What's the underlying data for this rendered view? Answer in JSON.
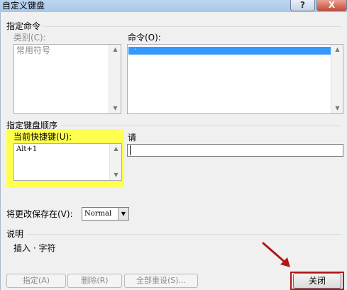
{
  "window": {
    "title": "自定义键盘",
    "help": "?",
    "close": "X"
  },
  "specify_command": {
    "heading": "指定命令",
    "categories_label": "类别(C):",
    "categories": [
      "常用符号"
    ],
    "commands_label": "命令(O):",
    "commands": [
      "·"
    ]
  },
  "keyboard_sequence": {
    "heading": "指定键盘顺序",
    "current_keys_label": "当前快捷键(U):",
    "current_keys": [
      "Alt+1"
    ],
    "press_label": "请",
    "press_value": ""
  },
  "save_in": {
    "label": "将更改保存在(V):",
    "value": "Normal"
  },
  "description": {
    "heading": "说明",
    "text": "插入 · 字符"
  },
  "buttons": {
    "assign": "指定(A)",
    "remove": "删除(R)",
    "reset_all": "全部重设(S)...",
    "close": "关闭"
  },
  "colors": {
    "highlight": "#ffff4d",
    "annotation": "#b01818",
    "selection": "#3399ff"
  }
}
